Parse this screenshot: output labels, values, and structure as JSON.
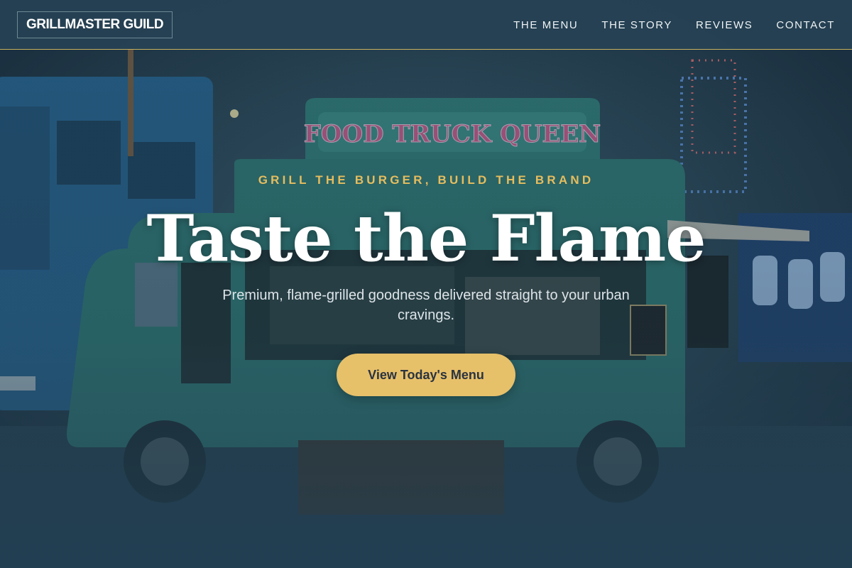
{
  "nav": {
    "logo": "GRILLMASTER GUILD",
    "links": [
      {
        "label": "THE MENU"
      },
      {
        "label": "THE STORY"
      },
      {
        "label": "REVIEWS"
      },
      {
        "label": "CONTACT"
      }
    ]
  },
  "hero": {
    "tagline": "GRILL THE BURGER, BUILD THE BRAND",
    "title": "Taste the Flame",
    "subtitle": "Premium, flame-grilled goodness delivered straight to your urban cravings.",
    "cta_label": "View Today's Menu",
    "background": {
      "truck_sign": "FOOD TRUCK QUEEN"
    }
  },
  "colors": {
    "accent": "#e7c06a",
    "tagline": "#e6bd5e",
    "nav_background": "#264254",
    "nav_border": "#c9b15f",
    "truck_teal": "#2f7f78"
  }
}
